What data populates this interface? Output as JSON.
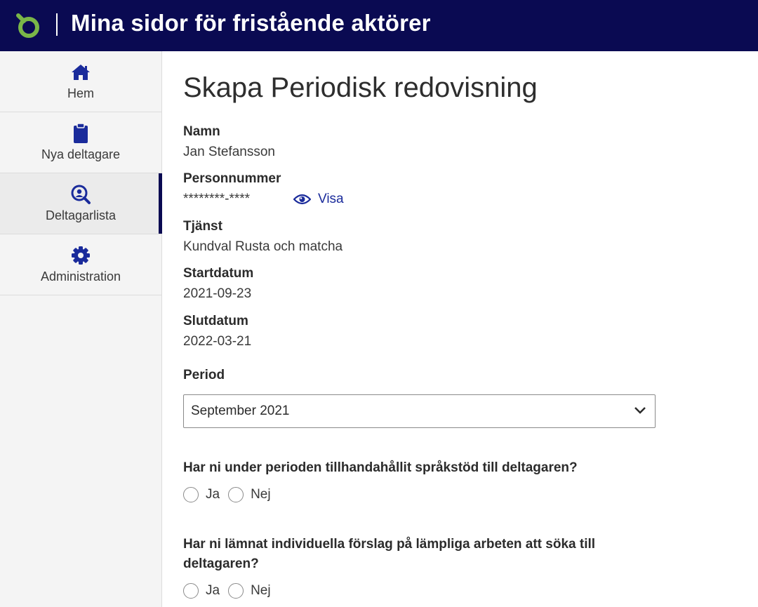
{
  "header": {
    "title": "Mina sidor för fristående aktörer",
    "logo_icon": "brand-logo-icon",
    "background": "#0a0a52",
    "logo_color": "#7ab648"
  },
  "sidebar": {
    "items": [
      {
        "label": "Hem",
        "icon": "home-icon",
        "active": false
      },
      {
        "label": "Nya deltagare",
        "icon": "clipboard-icon",
        "active": false
      },
      {
        "label": "Deltagarlista",
        "icon": "search-person-icon",
        "active": true
      },
      {
        "label": "Administration",
        "icon": "gear-icon",
        "active": false
      }
    ],
    "icon_color": "#1a2b9b"
  },
  "main": {
    "title": "Skapa Periodisk redovisning",
    "fields": [
      {
        "label": "Namn",
        "value": "Jan Stefansson"
      },
      {
        "label": "Personnummer",
        "value": "********-****",
        "action": "Visa",
        "action_icon": "eye-icon"
      },
      {
        "label": "Tjänst",
        "value": "Kundval Rusta och matcha"
      },
      {
        "label": "Startdatum",
        "value": "2021-09-23"
      },
      {
        "label": "Slutdatum",
        "value": "2022-03-21"
      }
    ],
    "period": {
      "label": "Period",
      "selected": "September 2021",
      "icon": "chevron-down-icon"
    },
    "questions": [
      {
        "text": "Har ni under perioden tillhandahållit språkstöd till deltagaren?",
        "options": [
          "Ja",
          "Nej"
        ]
      },
      {
        "text": "Har ni lämnat individuella förslag på lämpliga arbeten att söka till deltagaren?",
        "options": [
          "Ja",
          "Nej"
        ]
      }
    ]
  }
}
